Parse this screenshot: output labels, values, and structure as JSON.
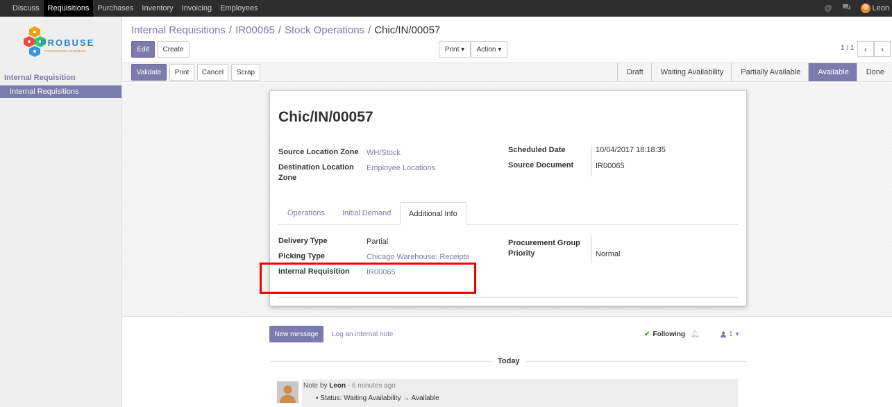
{
  "topbar": {
    "menu": [
      "Discuss",
      "Requisitions",
      "Purchases",
      "Inventory",
      "Invoicing",
      "Employees"
    ],
    "active": "Requisitions",
    "user": "Leon"
  },
  "sidebar": {
    "logo_name": "PROBUSE",
    "logo_tagline": "PROFESSIONAL BUSINESS",
    "section": "Internal Requisition",
    "item": "Internal Requisitions"
  },
  "breadcrumb": {
    "b1": "Internal Requisitions",
    "b2": "IR00065",
    "b3": "Stock Operations",
    "current": "Chic/IN/00057",
    "sep": "/"
  },
  "toolbar": {
    "edit": "Edit",
    "create": "Create",
    "print": "Print ▾",
    "action": "Action ▾",
    "pager": "1 / 1"
  },
  "statusbar": {
    "validate": "Validate",
    "print": "Print",
    "cancel": "Cancel",
    "scrap": "Scrap",
    "stages": [
      "Draft",
      "Waiting Availability",
      "Partially Available",
      "Available",
      "Done"
    ],
    "active_stage": "Available"
  },
  "form": {
    "title": "Chic/IN/00057",
    "source_location_label": "Source Location Zone",
    "source_location_value": "WH/Stock",
    "dest_location_label_1": "Destination Location",
    "dest_location_label_2": "Zone",
    "dest_location_value": "Employee Locations",
    "scheduled_date_label": "Scheduled Date",
    "scheduled_date_value": "10/04/2017 18:18:35",
    "source_document_label": "Source Document",
    "source_document_value": "IR00065",
    "tabs": [
      "Operations",
      "Initial Demand",
      "Additional Info"
    ],
    "active_tab": "Additional Info",
    "delivery_type_label": "Delivery Type",
    "delivery_type_value": "Partial",
    "picking_type_label": "Picking Type",
    "picking_type_value": "Chicago Warehouse: Receipts",
    "internal_req_label": "Internal Requisition",
    "internal_req_value": "IR00065",
    "procurement_label_1": "Procurement Group",
    "procurement_label_2": "Priority",
    "procurement_value": "Normal"
  },
  "chatter": {
    "new_message": "New message",
    "log_note": "Log an internal note",
    "following": "Following",
    "followers_count": "1",
    "today": "Today",
    "note_prefix": "Note by",
    "author": "Leon",
    "time": "- 6 minutes ago",
    "status_line": "Status: Waiting Availability → Available"
  },
  "colors": {
    "accent": "#7c7bad",
    "topbar": "#2d2d2d",
    "highlight": "#ee0000"
  }
}
